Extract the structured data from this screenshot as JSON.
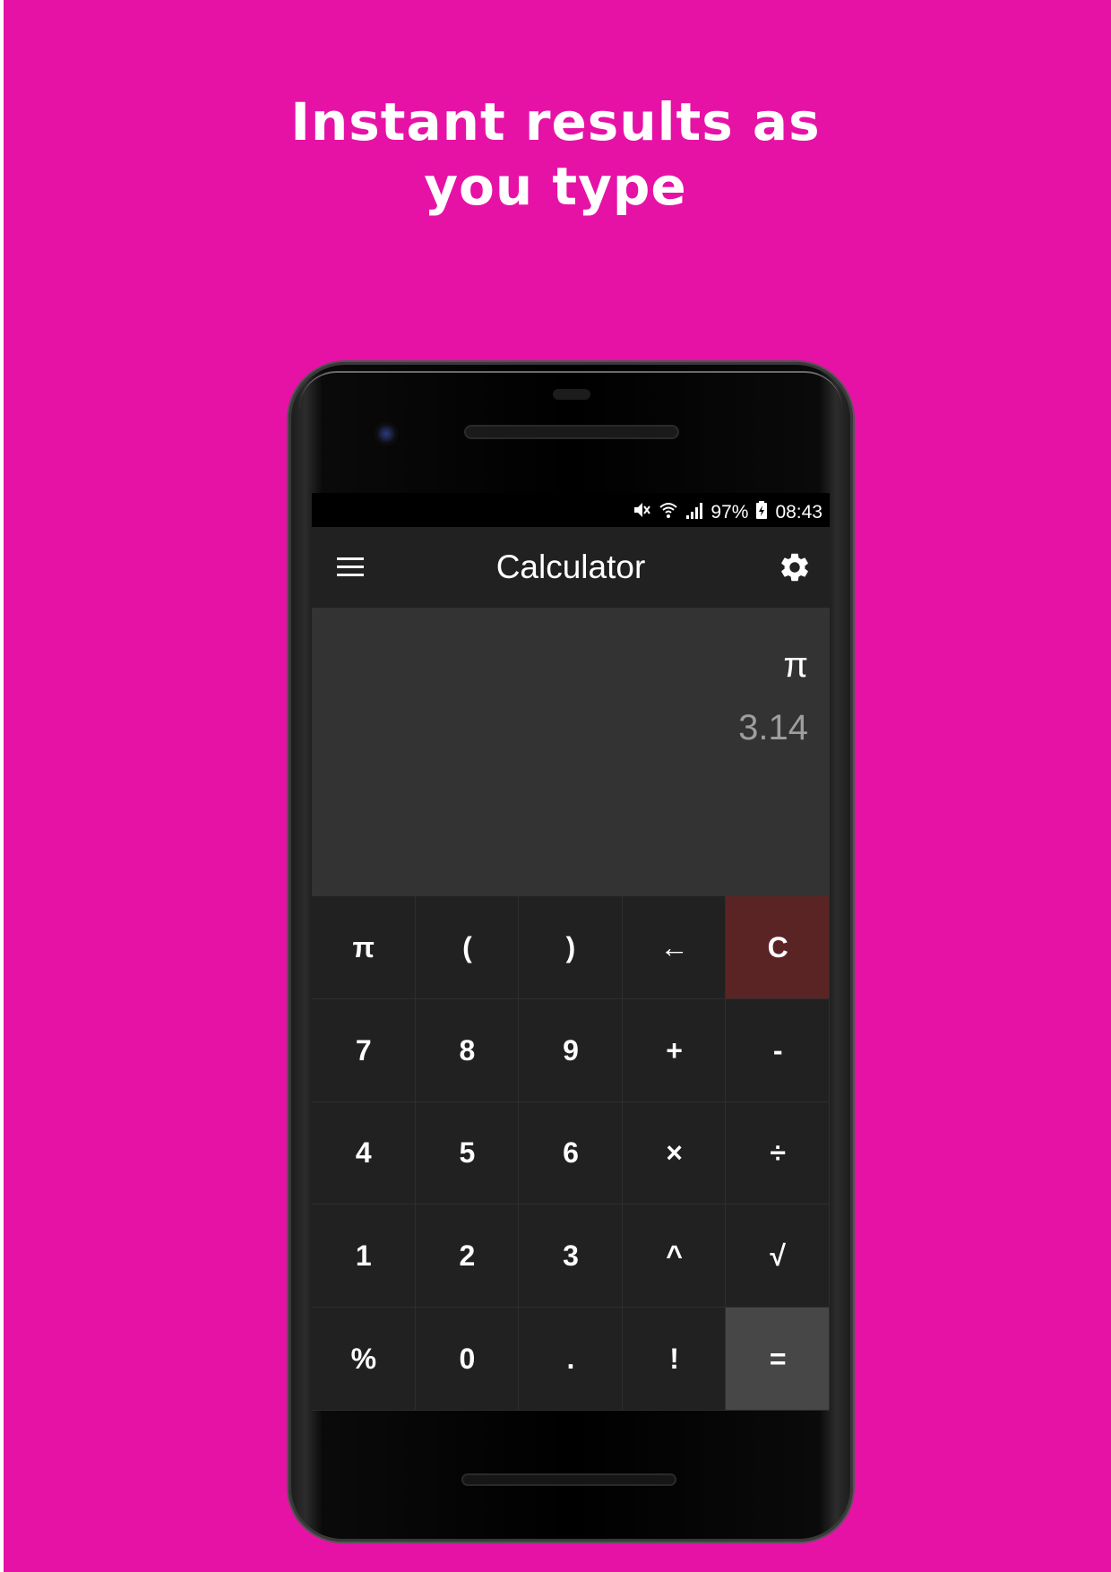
{
  "headline": {
    "line1": "Instant results as",
    "line2": "you type"
  },
  "colors": {
    "background": "#e612a6",
    "app_bar": "#212121",
    "display": "#333333",
    "key": "#212121",
    "clear_key": "#5b2424",
    "equals_key": "#474747",
    "result_text": "#9e9e9e"
  },
  "status_bar": {
    "icons": [
      "mute-icon",
      "wifi-icon",
      "signal-icon"
    ],
    "battery": "97%",
    "battery_icon": "battery-charging-icon",
    "time": "08:43"
  },
  "app_bar": {
    "menu_icon": "hamburger-menu-icon",
    "title": "Calculator",
    "settings_icon": "gear-icon"
  },
  "display": {
    "expression": "π",
    "result": "3.14"
  },
  "keypad": {
    "rows": [
      [
        "π",
        "(",
        ")",
        "←",
        "C"
      ],
      [
        "7",
        "8",
        "9",
        "+",
        "-"
      ],
      [
        "4",
        "5",
        "6",
        "×",
        "÷"
      ],
      [
        "1",
        "2",
        "3",
        "^",
        "√"
      ],
      [
        "%",
        "0",
        ".",
        "!",
        "="
      ]
    ]
  }
}
